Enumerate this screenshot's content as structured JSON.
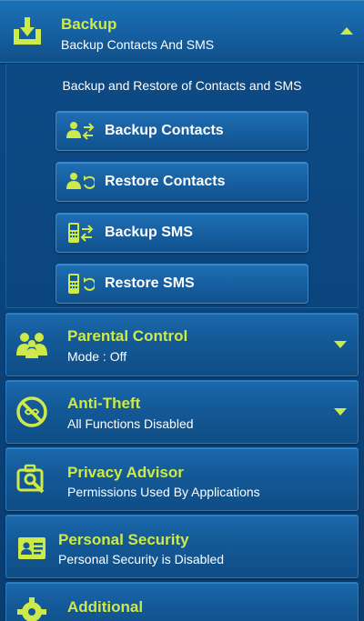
{
  "backup": {
    "title": "Backup",
    "subtitle": "Backup Contacts And SMS",
    "panel_title": "Backup and Restore of Contacts and SMS",
    "actions": [
      {
        "label": "Backup Contacts",
        "icon": "backup-contacts-icon"
      },
      {
        "label": "Restore Contacts",
        "icon": "restore-contacts-icon"
      },
      {
        "label": "Backup SMS",
        "icon": "backup-sms-icon"
      },
      {
        "label": "Restore SMS",
        "icon": "restore-sms-icon"
      }
    ]
  },
  "sections": [
    {
      "title": "Parental Control",
      "subtitle": "Mode : Off",
      "icon": "parental-control-icon",
      "expandable": true
    },
    {
      "title": "Anti-Theft",
      "subtitle": "All Functions Disabled",
      "icon": "anti-theft-icon",
      "expandable": true
    },
    {
      "title": "Privacy Advisor",
      "subtitle": "Permissions Used By Applications",
      "icon": "privacy-advisor-icon",
      "expandable": false
    },
    {
      "title": "Personal Security",
      "subtitle": "Personal Security is Disabled",
      "icon": "personal-security-icon",
      "expandable": false
    },
    {
      "title": "Additional",
      "subtitle": "",
      "icon": "additional-icon",
      "expandable": false
    }
  ],
  "colors": {
    "accent": "#cde94a",
    "background": "#0a3f73",
    "section": "#155e9e",
    "text": "#ffffff"
  }
}
